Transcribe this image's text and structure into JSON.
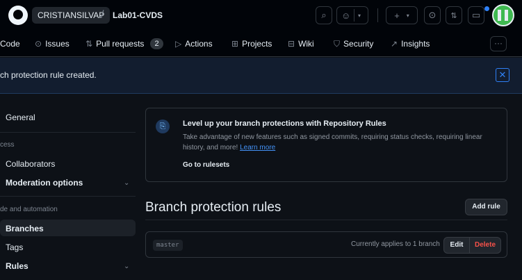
{
  "header": {
    "owner": "CRISTIANSILVAP",
    "separator": "/",
    "repo": "Lab01-CVDS",
    "icons": [
      "github-logo-icon",
      "search-icon",
      "copilot-icon",
      "chevron-down-icon",
      "plus-icon",
      "issue-icon",
      "pull-request-icon",
      "inbox-icon",
      "avatar"
    ]
  },
  "repo_nav": {
    "items": [
      {
        "label": "Code",
        "icon": "code-icon"
      },
      {
        "label": "Issues",
        "icon": "issue-icon"
      },
      {
        "label": "Pull requests",
        "icon": "pull-request-icon",
        "count": "2"
      },
      {
        "label": "Actions",
        "icon": "play-icon"
      },
      {
        "label": "Projects",
        "icon": "table-icon"
      },
      {
        "label": "Wiki",
        "icon": "book-icon"
      },
      {
        "label": "Security",
        "icon": "shield-icon"
      },
      {
        "label": "Insights",
        "icon": "graph-icon"
      }
    ],
    "more": "···"
  },
  "flash": {
    "message": "ch protection rule created.",
    "close": "✕"
  },
  "sidebar": {
    "general": "General",
    "access_heading": "cess",
    "collaborators": "Collaborators",
    "moderation": "Moderation options",
    "code_heading": "de and automation",
    "branches": "Branches",
    "tags": "Tags",
    "rules": "Rules"
  },
  "rulesets_card": {
    "title": "Level up your branch protections with Repository Rules",
    "body": "Take advantage of new features such as signed commits, requiring status checks, requiring linear history, and more!",
    "link": "Learn more",
    "cta": "Go to rulesets"
  },
  "branch_rules": {
    "title": "Branch protection rules",
    "add_rule": "Add rule",
    "rules": [
      {
        "branch": "master",
        "applies": "Currently applies to 1 branch",
        "edit": "Edit",
        "delete": "Delete"
      }
    ]
  },
  "colors": {
    "background": "#0d1117",
    "header": "#010409",
    "accent": "#2f81f7",
    "danger": "#f85149",
    "flash_bg": "#121d2f"
  }
}
